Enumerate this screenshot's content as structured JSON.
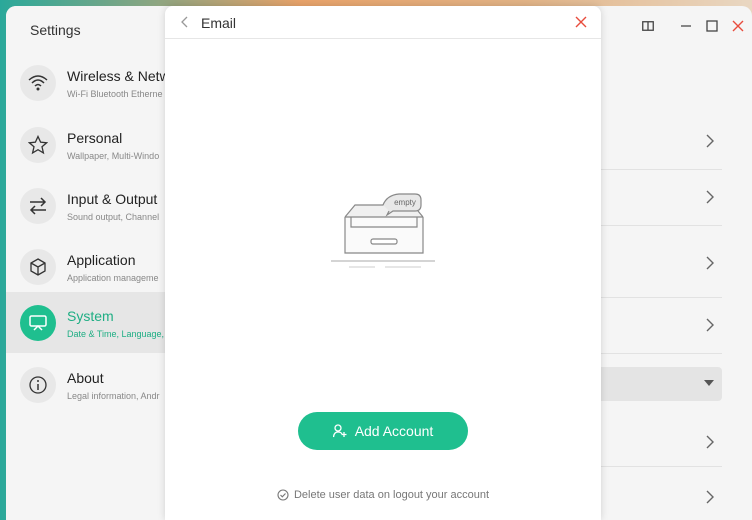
{
  "app": {
    "title": "Settings"
  },
  "sidebar": {
    "items": [
      {
        "title": "Wireless & Netw",
        "subtitle": "Wi-Fi Bluetooth Etherne",
        "icon": "wifi-icon"
      },
      {
        "title": "Personal",
        "subtitle": "Wallpaper, Multi-Windo",
        "icon": "star-icon"
      },
      {
        "title": "Input & Output",
        "subtitle": "Sound output, Channel",
        "icon": "swap-arrows-icon"
      },
      {
        "title": "Application",
        "subtitle": "Application manageme",
        "icon": "cube-icon"
      },
      {
        "title": "System",
        "subtitle": "Date & Time, Language,",
        "icon": "monitor-icon",
        "active": true
      },
      {
        "title": "About",
        "subtitle": "Legal information, Andr",
        "icon": "info-icon"
      }
    ]
  },
  "dialog": {
    "title": "Email",
    "empty_label": "empty",
    "add_button_label": "Add Account",
    "footnote": "Delete user data on logout your account"
  },
  "colors": {
    "accent": "#1fbf8f",
    "close": "#e84c3d"
  }
}
